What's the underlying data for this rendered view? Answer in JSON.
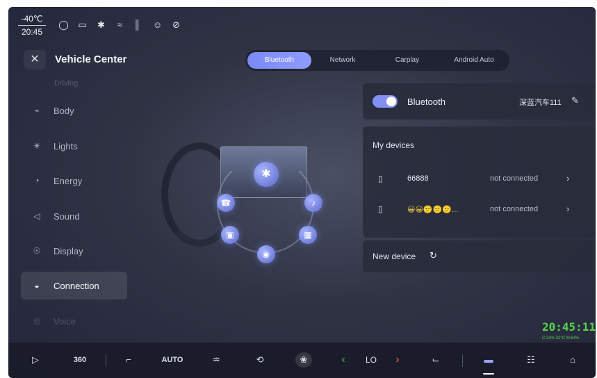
{
  "status_bar": {
    "temperature": "-40℃",
    "time": "20:45",
    "icons": [
      "shield-icon",
      "tag-icon",
      "bluetooth-icon",
      "wifi-icon",
      "signal-icon",
      "user-icon",
      "no-camera-icon"
    ]
  },
  "header": {
    "close_glyph": "✕",
    "title": "Vehicle Center"
  },
  "tabs": [
    {
      "label": "Bluetooth",
      "active": true
    },
    {
      "label": "Network",
      "active": false
    },
    {
      "label": "Carplay",
      "active": false
    },
    {
      "label": "Android Auto",
      "active": false
    }
  ],
  "menu": {
    "faded_top": "Driving",
    "items": [
      {
        "label": "Body",
        "icon": "car-body-icon",
        "glyph": "⌁"
      },
      {
        "label": "Lights",
        "icon": "lights-icon",
        "glyph": "☀"
      },
      {
        "label": "Energy",
        "icon": "energy-icon",
        "glyph": "◔"
      },
      {
        "label": "Sound",
        "icon": "speaker-icon",
        "glyph": "◁"
      },
      {
        "label": "Display",
        "icon": "display-icon",
        "glyph": "☉"
      },
      {
        "label": "Connection",
        "icon": "connection-icon",
        "glyph": "◒"
      },
      {
        "label": "Voice",
        "icon": "voice-icon",
        "glyph": "◎"
      }
    ],
    "active_index": 5
  },
  "illustration": {
    "center_icon": "bluetooth-icon",
    "center_glyph": "✱",
    "orbit_icons": [
      {
        "name": "phone-icon",
        "glyph": "☎"
      },
      {
        "name": "music-icon",
        "glyph": "♪"
      },
      {
        "name": "gamepad-icon",
        "glyph": "▣"
      },
      {
        "name": "apps-icon",
        "glyph": "▦"
      },
      {
        "name": "location-icon",
        "glyph": "◉"
      }
    ]
  },
  "bluetooth_panel": {
    "toggle_on": true,
    "label": "Bluetooth",
    "device_name": "深蓝汽车111",
    "edit_glyph": "✎"
  },
  "devices_panel": {
    "header": "My devices",
    "devices": [
      {
        "name": "66888",
        "status": "not connected",
        "icon_glyph": "▯",
        "chevron": "›"
      },
      {
        "name": "😀😀🙂🙂🙂...",
        "status": "not connected",
        "icon_glyph": "▯",
        "chevron": "›"
      }
    ]
  },
  "new_device": {
    "label": "New device",
    "refresh_glyph": "↻"
  },
  "clock_overlay": {
    "time": "20:45:11",
    "info": "C:34% 32°C M:64%"
  },
  "dock": {
    "items": [
      {
        "name": "camera-dock-icon",
        "glyph": "▷"
      },
      {
        "name": "360-view-button",
        "text": "360"
      },
      {
        "name": "seat-dock-icon",
        "glyph": "⌐"
      },
      {
        "name": "auto-button",
        "text": "AUTO"
      },
      {
        "name": "rear-defrost-icon",
        "glyph": "♒"
      },
      {
        "name": "air-circulation-icon",
        "glyph": "⟲"
      },
      {
        "name": "fan-icon",
        "glyph": "❀"
      },
      {
        "name": "temp-down-button",
        "glyph": "‹"
      },
      {
        "name": "temp-value",
        "text": "LO"
      },
      {
        "name": "temp-up-button",
        "glyph": "›"
      },
      {
        "name": "seat-heat-icon",
        "glyph": "⌙"
      },
      {
        "name": "vehicle-dock-icon",
        "glyph": "▬"
      },
      {
        "name": "apps-grid-icon",
        "glyph": "☷"
      },
      {
        "name": "home-icon",
        "glyph": "⌂"
      }
    ]
  }
}
